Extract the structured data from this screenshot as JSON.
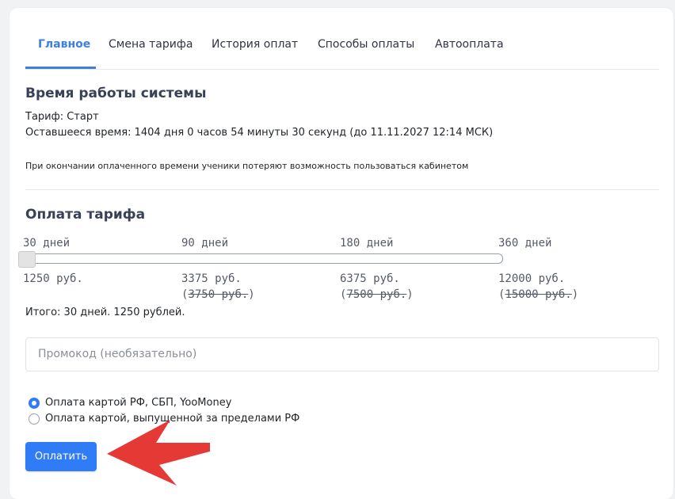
{
  "tabs": [
    {
      "label": "Главное",
      "active": true
    },
    {
      "label": "Смена тарифа",
      "active": false
    },
    {
      "label": "История оплат",
      "active": false
    },
    {
      "label": "Способы оплаты",
      "active": false
    },
    {
      "label": "Автооплата",
      "active": false
    }
  ],
  "uptime": {
    "title": "Время работы системы",
    "tariff": "Тариф: Старт",
    "remaining": "Оставшееся время: 1404 дня 0 часов 54 минуты 30 секунд (до 11.11.2027 12:14 МСК)",
    "notice": "При окончании оплаченного времени ученики потеряют возможность пользоваться кабинетом"
  },
  "payment": {
    "title": "Оплата тарифа",
    "periods": [
      {
        "label": "30 дней",
        "price": "1250 руб.",
        "old_price": ""
      },
      {
        "label": "90 дней",
        "price": "3375 руб.",
        "old_price": "3750 руб."
      },
      {
        "label": "180 дней",
        "price": "6375 руб.",
        "old_price": "7500 руб."
      },
      {
        "label": "360 дней",
        "price": "12000 руб.",
        "old_price": "15000 руб."
      }
    ],
    "slider_selected_index": 0,
    "total": "Итого: 30 дней. 1250 рублей.",
    "promo_placeholder": "Промокод (необязательно)",
    "methods": [
      {
        "label": "Оплата картой РФ, СБП, YooMoney",
        "checked": true
      },
      {
        "label": "Оплата картой, выпущенной за пределами РФ",
        "checked": false
      }
    ],
    "pay_button": "Оплатить"
  },
  "colors": {
    "accent": "#3f7fdc",
    "button": "#2f7cf6",
    "arrow": "#e53935"
  }
}
